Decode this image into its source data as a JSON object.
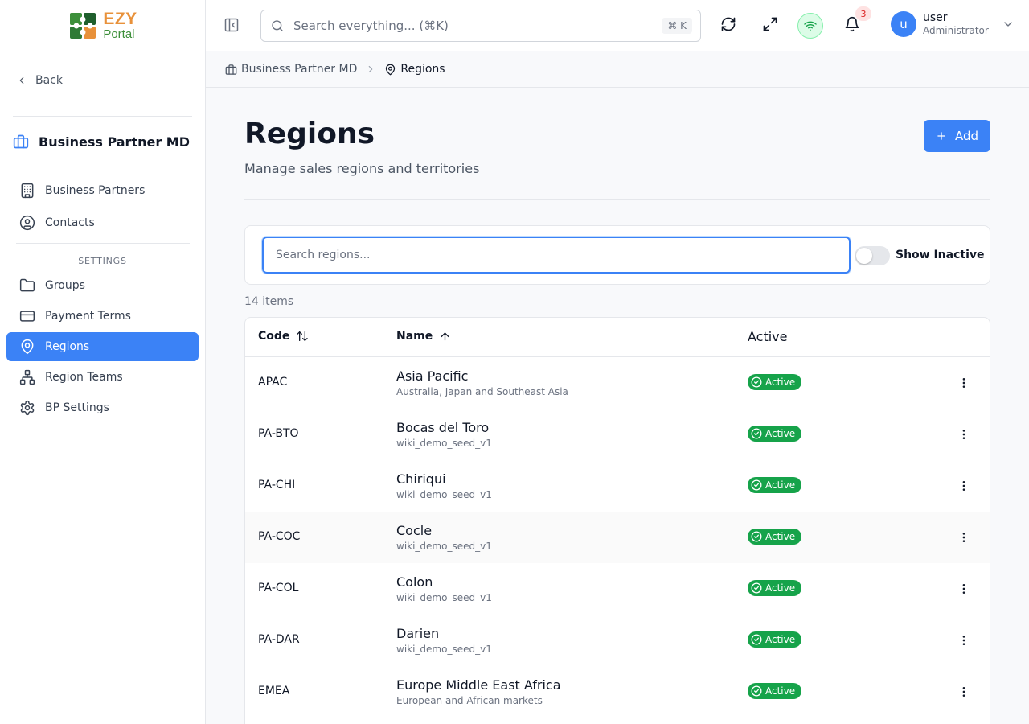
{
  "brand": {
    "line1": "EZY",
    "line2": "Portal"
  },
  "sidebar": {
    "back_label": "Back",
    "module_title": "Business Partner MD",
    "items": [
      {
        "label": "Business Partners",
        "icon": "building-icon"
      },
      {
        "label": "Contacts",
        "icon": "contact-circle-icon"
      }
    ],
    "settings_label": "SETTINGS",
    "settings_items": [
      {
        "label": "Groups",
        "icon": "folder-icon"
      },
      {
        "label": "Payment Terms",
        "icon": "credit-card-icon"
      },
      {
        "label": "Regions",
        "icon": "map-pin-icon",
        "active": true
      },
      {
        "label": "Region Teams",
        "icon": "network-icon"
      },
      {
        "label": "BP Settings",
        "icon": "gear-icon"
      }
    ]
  },
  "topbar": {
    "search_placeholder": "Search everything... (⌘K)",
    "search_shortcut": "⌘ K",
    "notification_count": "3",
    "user_name": "user",
    "user_role": "Administrator",
    "avatar_letter": "u"
  },
  "breadcrumb": {
    "parent": "Business Partner MD",
    "current": "Regions"
  },
  "page": {
    "title": "Regions",
    "subtitle": "Manage sales regions and territories",
    "add_label": "Add",
    "search_placeholder": "Search regions...",
    "show_inactive_label": "Show Inactive",
    "show_inactive": false,
    "item_count": "14 items"
  },
  "table": {
    "columns": {
      "code": "Code",
      "name": "Name",
      "active": "Active"
    },
    "rows": [
      {
        "code": "APAC",
        "name": "Asia Pacific",
        "description": "Australia, Japan and Southeast Asia",
        "status": "Active"
      },
      {
        "code": "PA-BTO",
        "name": "Bocas del Toro",
        "description": "wiki_demo_seed_v1",
        "status": "Active"
      },
      {
        "code": "PA-CHI",
        "name": "Chiriqui",
        "description": "wiki_demo_seed_v1",
        "status": "Active"
      },
      {
        "code": "PA-COC",
        "name": "Cocle",
        "description": "wiki_demo_seed_v1",
        "status": "Active"
      },
      {
        "code": "PA-COL",
        "name": "Colon",
        "description": "wiki_demo_seed_v1",
        "status": "Active"
      },
      {
        "code": "PA-DAR",
        "name": "Darien",
        "description": "wiki_demo_seed_v1",
        "status": "Active"
      },
      {
        "code": "EMEA",
        "name": "Europe Middle East Africa",
        "description": "European and African markets",
        "status": "Active"
      }
    ]
  },
  "colors": {
    "accent": "#3b82f6",
    "active_badge": "#16a34a",
    "notification_badge": "#dc2626"
  }
}
